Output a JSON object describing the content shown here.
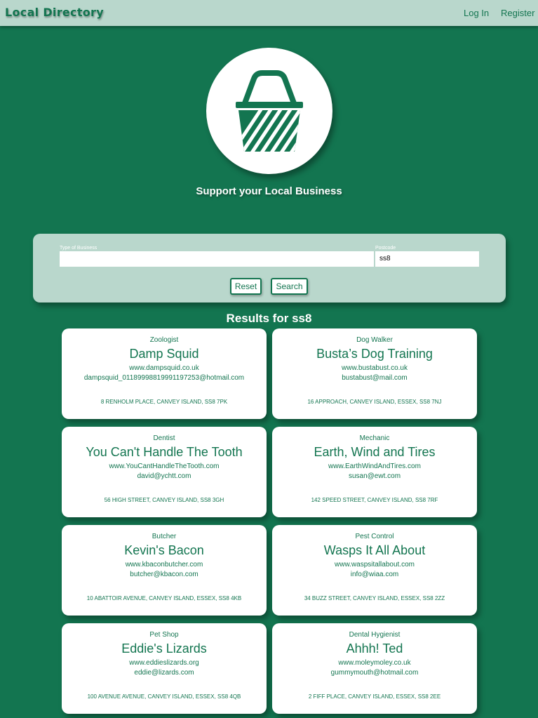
{
  "nav": {
    "brand": "Local Directory",
    "login": "Log In",
    "register": "Register"
  },
  "hero": {
    "logo_icon": "shopping-basket-icon",
    "tagline": "Support your Local Business"
  },
  "search": {
    "type_label": "Type of Business",
    "type_value": "",
    "postcode_label": "Postcode",
    "postcode_value": "ss8",
    "reset_label": "Reset",
    "search_label": "Search"
  },
  "results": {
    "title": "Results for ss8",
    "items": [
      {
        "category": "Zoologist",
        "name": "Damp Squid",
        "website": "www.dampsquid.co.uk",
        "email": "dampsquid_01189998819991197253@hotmail.com",
        "address": "8 RENHOLM PLACE, CANVEY ISLAND, SS8 7PK"
      },
      {
        "category": "Dog Walker",
        "name": "Busta’s Dog Training",
        "website": "www.bustabust.co.uk",
        "email": "bustabust@mail.com",
        "address": "16 APPROACH, CANVEY ISLAND, ESSEX, SS8 7NJ"
      },
      {
        "category": "Dentist",
        "name": "You Can't Handle The Tooth",
        "website": "www.YouCantHandleTheTooth.com",
        "email": "david@ychtt.com",
        "address": "56 HIGH STREET, CANVEY ISLAND, SS8 3GH"
      },
      {
        "category": "Mechanic",
        "name": "Earth, Wind and Tires",
        "website": "www.EarthWindAndTires.com",
        "email": "susan@ewt.com",
        "address": "142 SPEED STREET, CANVEY ISLAND, SS8 7RF"
      },
      {
        "category": "Butcher",
        "name": "Kevin's Bacon",
        "website": "www.kbaconbutcher.com",
        "email": "butcher@kbacon.com",
        "address": "10 ABATTOIR AVENUE, CANVEY ISLAND, ESSEX, SS8 4KB"
      },
      {
        "category": "Pest Control",
        "name": "Wasps It All About",
        "website": "www.waspsitallabout.com",
        "email": "info@wiaa.com",
        "address": "34 BUZZ STREET, CANVEY ISLAND, ESSEX, SS8 2ZZ"
      },
      {
        "category": "Pet Shop",
        "name": "Eddie's Lizards",
        "website": "www.eddieslizards.org",
        "email": "eddie@lizards.com",
        "address": "100 AVENUE AVENUE, CANVEY ISLAND, ESSEX, SS8 4QB"
      },
      {
        "category": "Dental Hygienist",
        "name": "Ahhh! Ted",
        "website": "www.moleymoley.co.uk",
        "email": "gummymouth@hotmail.com",
        "address": "2 FIFF PLACE, CANVEY ISLAND, ESSEX, SS8 2EE"
      }
    ]
  },
  "colors": {
    "background": "#137550",
    "panel": "#b9d7cc",
    "accent": "#137550",
    "card": "#ffffff"
  }
}
